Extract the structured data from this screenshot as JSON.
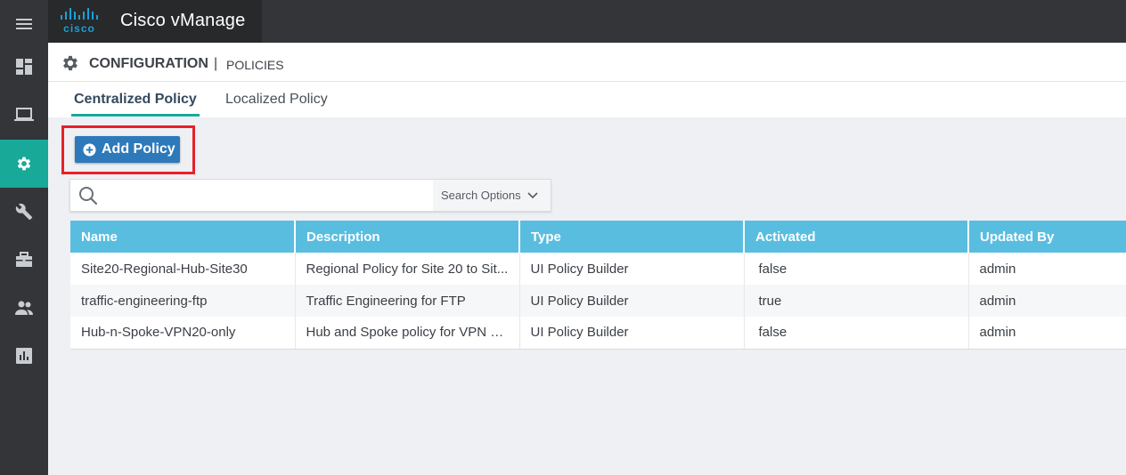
{
  "app": {
    "title": "Cisco vManage",
    "logo_text": "cisco"
  },
  "sidebar": {
    "items": [
      {
        "icon": "dashboard-icon"
      },
      {
        "icon": "monitor-icon"
      },
      {
        "icon": "gear-icon",
        "active": true
      },
      {
        "icon": "wrench-icon"
      },
      {
        "icon": "briefcase-icon"
      },
      {
        "icon": "users-icon"
      },
      {
        "icon": "analytics-icon"
      }
    ]
  },
  "page": {
    "title": "CONFIGURATION",
    "separator": "|",
    "subtitle": "POLICIES"
  },
  "tabs": [
    {
      "label": "Centralized Policy",
      "active": true
    },
    {
      "label": "Localized Policy",
      "active": false
    }
  ],
  "toolbar": {
    "add_label": "Add Policy"
  },
  "search": {
    "placeholder": "",
    "value": "",
    "options_label": "Search Options"
  },
  "table": {
    "columns": [
      "Name",
      "Description",
      "Type",
      "Activated",
      "Updated By"
    ],
    "rows": [
      [
        "Site20-Regional-Hub-Site30",
        "Regional Policy for Site 20 to Sit...",
        "UI Policy Builder",
        "false",
        "admin"
      ],
      [
        "traffic-engineering-ftp",
        "Traffic Engineering for FTP",
        "UI Policy Builder",
        "true",
        "admin"
      ],
      [
        "Hub-n-Spoke-VPN20-only",
        "Hub and Spoke policy for VPN 2...",
        "UI Policy Builder",
        "false",
        "admin"
      ]
    ]
  },
  "colors": {
    "sidebar_bg": "#333538",
    "accent": "#18a999",
    "table_header": "#59bde0",
    "button": "#2e79b9",
    "highlight": "#e8202a"
  }
}
